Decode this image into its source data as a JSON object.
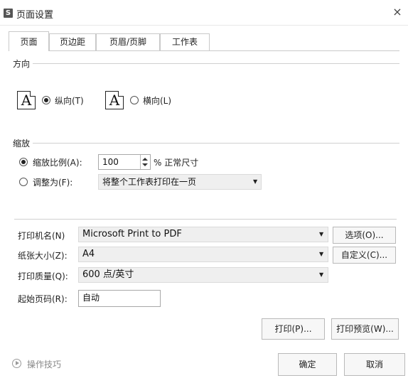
{
  "window": {
    "app_icon": "S",
    "title": "页面设置",
    "close": "×"
  },
  "tabs": [
    {
      "label": "页面"
    },
    {
      "label": "页边距"
    },
    {
      "label": "页眉/页脚"
    },
    {
      "label": "工作表"
    }
  ],
  "orientation": {
    "group_label": "方向",
    "portrait": {
      "icon_letter": "A",
      "label": "纵向(T)",
      "selected": true
    },
    "landscape": {
      "icon_letter": "A",
      "label": "横向(L)",
      "selected": false
    }
  },
  "scaling": {
    "group_label": "缩放",
    "scale_ratio": {
      "label": "缩放比例(A):",
      "value": "100",
      "suffix": "% 正常尺寸",
      "selected": true
    },
    "fit_to": {
      "label": "调整为(F):",
      "value": "将整个工作表打印在一页",
      "selected": false
    }
  },
  "printer": {
    "label": "打印机名(N)",
    "value": "Microsoft Print to PDF",
    "options_button": "选项(O)..."
  },
  "paper_size": {
    "label": "纸张大小(Z):",
    "value": "A4",
    "custom_button": "自定义(C)..."
  },
  "print_quality": {
    "label": "打印质量(Q):",
    "value": "600 点/英寸"
  },
  "start_page": {
    "label": "起始页码(R):",
    "value": "自动"
  },
  "actions": {
    "print": "打印(P)...",
    "preview": "打印预览(W)..."
  },
  "footer": {
    "tips": "操作技巧",
    "ok": "确定",
    "cancel": "取消"
  }
}
